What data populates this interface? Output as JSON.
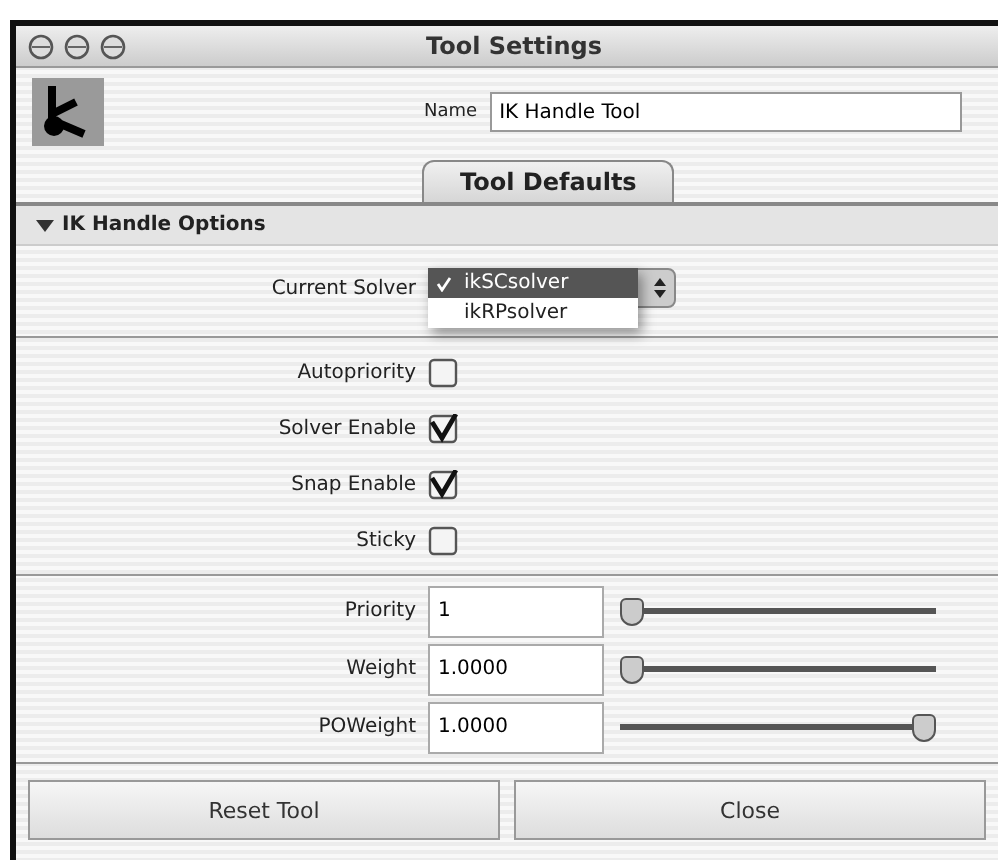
{
  "window": {
    "title": "Tool Settings"
  },
  "name_field": {
    "label": "Name",
    "value": "IK Handle Tool"
  },
  "tabs": [
    {
      "label": "Tool Defaults",
      "selected": true
    }
  ],
  "section": {
    "title": "IK Handle Options",
    "expanded": true
  },
  "solver": {
    "label": "Current Solver",
    "options": [
      {
        "label": "ikSCsolver",
        "selected": true
      },
      {
        "label": "ikRPsolver",
        "selected": false
      }
    ]
  },
  "checkboxes": [
    {
      "label": "Autopriority",
      "checked": false
    },
    {
      "label": "Solver Enable",
      "checked": true
    },
    {
      "label": "Snap Enable",
      "checked": true
    },
    {
      "label": "Sticky",
      "checked": false
    }
  ],
  "sliders": [
    {
      "label": "Priority",
      "value": "1",
      "level": 0
    },
    {
      "label": "Weight",
      "value": "1.0000",
      "level": 0
    },
    {
      "label": "POWeight",
      "value": "1.0000",
      "level": 1
    }
  ],
  "buttons": [
    "Reset Tool",
    "Close"
  ]
}
